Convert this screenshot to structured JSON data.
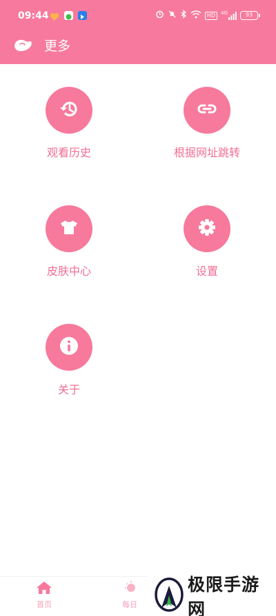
{
  "status_bar": {
    "time": "09:44",
    "network": "4G",
    "hd": "HD",
    "battery": "93"
  },
  "app_bar": {
    "title": "更多"
  },
  "menu": [
    {
      "label": "观看历史",
      "icon": "history-icon"
    },
    {
      "label": "根据网址跳转",
      "icon": "link-icon"
    },
    {
      "label": "皮肤中心",
      "icon": "tshirt-icon"
    },
    {
      "label": "设置",
      "icon": "gear-icon"
    },
    {
      "label": "关于",
      "icon": "info-icon"
    }
  ],
  "bottom_nav": [
    {
      "label": "首页",
      "icon": "home-icon"
    },
    {
      "label": "每日",
      "icon": "sun-icon"
    }
  ],
  "watermark": {
    "text": "极限手游网"
  },
  "colors": {
    "accent": "#f77a9e",
    "label": "#f06e94",
    "nav_label": "#f5a0b8"
  }
}
